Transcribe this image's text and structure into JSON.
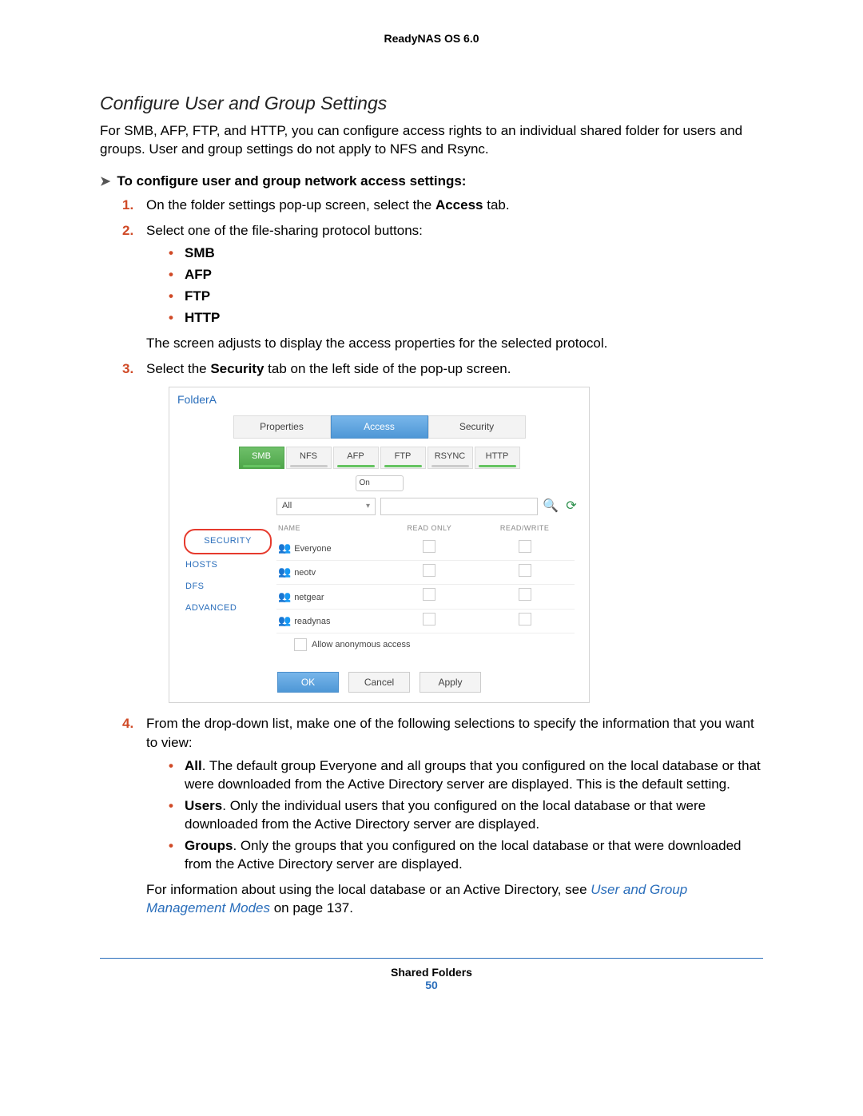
{
  "doc": {
    "header": "ReadyNAS OS 6.0",
    "footer_section": "Shared Folders",
    "page_number": "50"
  },
  "section_title": "Configure User and Group Settings",
  "intro": "For SMB, AFP, FTP, and HTTP, you can configure access rights to an individual shared folder for users and groups. User and group settings do not apply to NFS and Rsync.",
  "proc_heading": "To configure user and group network access settings:",
  "step1_a": "On the folder settings pop-up screen, select the ",
  "step1_b": "Access",
  "step1_c": " tab.",
  "step2": "Select one of the file-sharing protocol buttons:",
  "protocols": [
    "SMB",
    "AFP",
    "FTP",
    "HTTP"
  ],
  "step2_after": "The screen adjusts to display the access properties for the selected protocol.",
  "step3_a": "Select the ",
  "step3_b": "Security",
  "step3_c": " tab on the left side of the pop-up screen.",
  "screenshot": {
    "folder_name": "FolderA",
    "main_tabs": [
      "Properties",
      "Access",
      "Security"
    ],
    "main_active": "Access",
    "proto_tabs": [
      {
        "label": "SMB",
        "active": true,
        "off": false
      },
      {
        "label": "NFS",
        "active": false,
        "off": true
      },
      {
        "label": "AFP",
        "active": false,
        "off": false
      },
      {
        "label": "FTP",
        "active": false,
        "off": false
      },
      {
        "label": "RSYNC",
        "active": false,
        "off": true
      },
      {
        "label": "HTTP",
        "active": false,
        "off": false
      }
    ],
    "toggle_label": "On",
    "side_items": [
      "SECURITY",
      "HOSTS",
      "DFS",
      "ADVANCED"
    ],
    "dropdown_value": "All",
    "col_name": "NAME",
    "col_ro": "READ ONLY",
    "col_rw": "READ/WRITE",
    "rows": [
      "Everyone",
      "neotv",
      "netgear",
      "readynas"
    ],
    "anon_label": "Allow anonymous access",
    "btn_ok": "OK",
    "btn_cancel": "Cancel",
    "btn_apply": "Apply"
  },
  "step4_intro": "From the drop-down list, make one of the following selections to specify the information that you want to view:",
  "options": [
    {
      "k": "All",
      "t": ". The default group Everyone and all groups that you configured on the local database or that were downloaded from the Active Directory server are displayed. This is the default setting."
    },
    {
      "k": "Users",
      "t": ". Only the individual users that you configured on the local database or that were downloaded from the Active Directory server are displayed."
    },
    {
      "k": "Groups",
      "t": ". Only the groups that you configured on the local database or that were downloaded from the Active Directory server are displayed."
    }
  ],
  "step4_after_a": "For information about using the local database or an Active Directory, see ",
  "step4_link": "User and Group Management Modes",
  "step4_after_b": " on page 137."
}
